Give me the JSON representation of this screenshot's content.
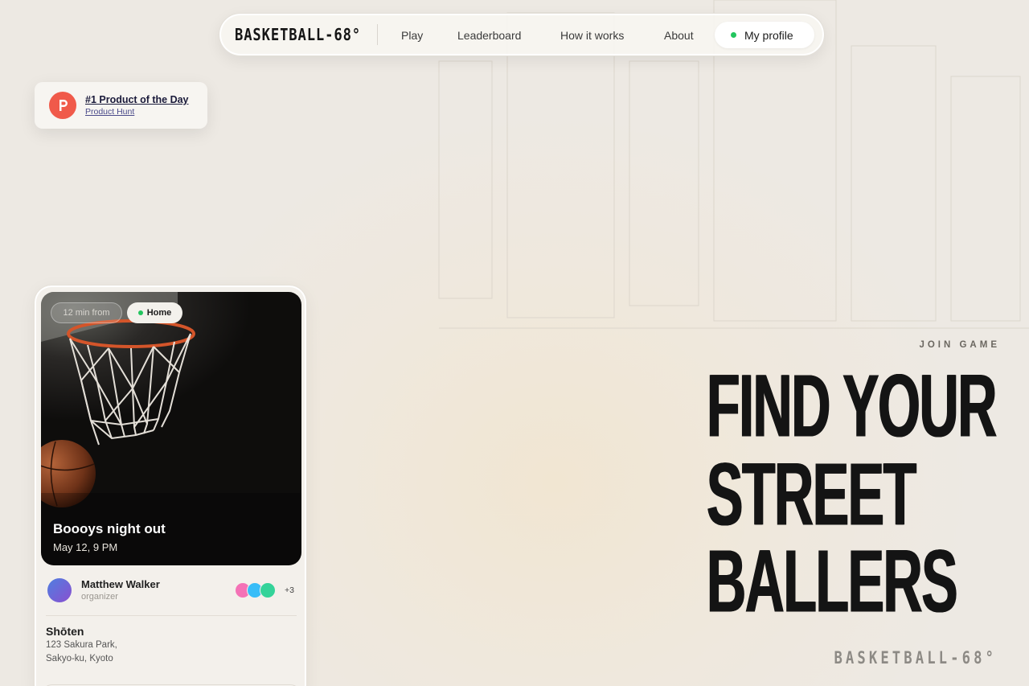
{
  "nav": {
    "brand": "BASKETBALL-68°",
    "links": [
      "Play",
      "Leaderboard",
      "How it works",
      "About"
    ],
    "profile_label": "My profile"
  },
  "badge": {
    "title": "#1 Product of the Day",
    "subtitle": "Product Hunt"
  },
  "card": {
    "time_chip": "12 min from",
    "home_chip": "Home",
    "event_title": "Boooys night out",
    "event_date": "May 12, 9 PM",
    "organizer_name": "Matthew Walker",
    "organizer_role": "organizer",
    "extra_count": "+3",
    "venue_name": "Shōten",
    "venue_address_1": "123 Sakura Park,",
    "venue_address_2": "Sakyo-ku, Kyoto"
  },
  "hero": {
    "eyebrow": "JOIN GAME",
    "line1": "FIND YOUR",
    "line2": "STREET",
    "line3": "BALLERS",
    "footer_brand": "BASKETBALL-68°"
  },
  "colors": {
    "accent_green": "#22c55e",
    "producthunt_orange": "#f05a4a",
    "background": "#ede9e3",
    "hero_text": "#141414"
  }
}
